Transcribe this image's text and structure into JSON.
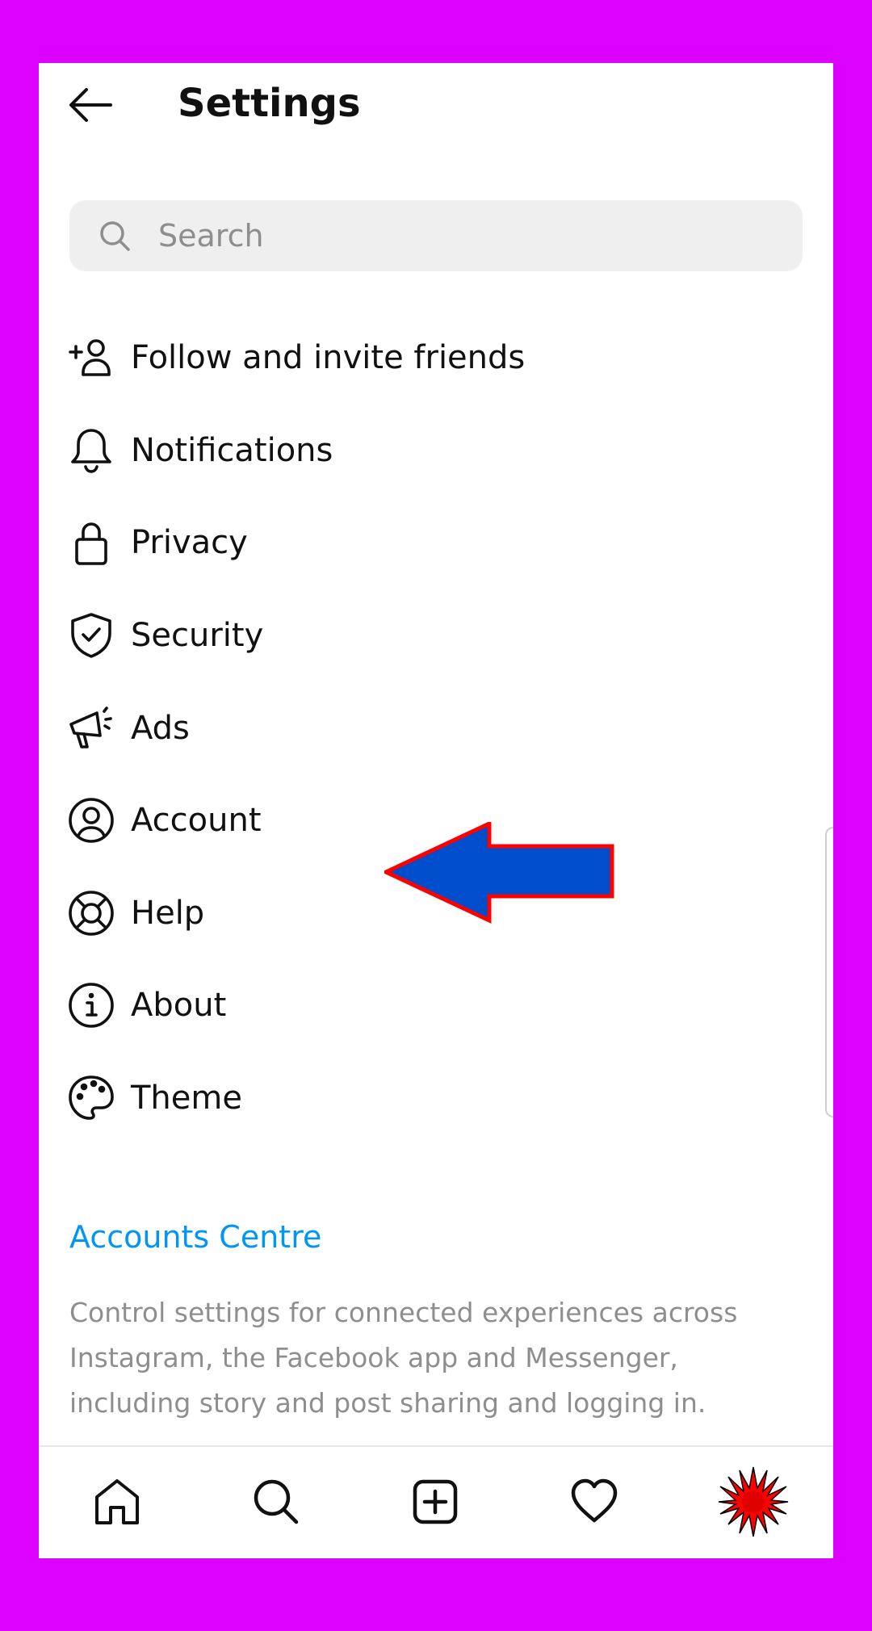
{
  "header": {
    "title": "Settings",
    "back_icon": "arrow-left-icon"
  },
  "search": {
    "placeholder": "Search",
    "value": "",
    "icon": "search-icon"
  },
  "menu": [
    {
      "label": "Follow and invite friends",
      "icon": "add-person-icon"
    },
    {
      "label": "Notifications",
      "icon": "bell-icon"
    },
    {
      "label": "Privacy",
      "icon": "lock-icon"
    },
    {
      "label": "Security",
      "icon": "shield-check-icon"
    },
    {
      "label": "Ads",
      "icon": "megaphone-icon"
    },
    {
      "label": "Account",
      "icon": "user-circle-icon"
    },
    {
      "label": "Help",
      "icon": "lifebuoy-icon"
    },
    {
      "label": "About",
      "icon": "info-icon"
    },
    {
      "label": "Theme",
      "icon": "palette-icon"
    }
  ],
  "accounts_centre": {
    "title": "Accounts Centre",
    "description": "Control settings for connected experiences across Instagram, the Facebook app and Messenger, including story and post sharing and logging in."
  },
  "bottom_nav": [
    {
      "icon": "home-icon"
    },
    {
      "icon": "search-icon"
    },
    {
      "icon": "plus-square-icon"
    },
    {
      "icon": "heart-icon"
    },
    {
      "icon": "profile-avatar-icon"
    }
  ],
  "colors": {
    "background": "#dd02ff",
    "link": "#0095f6",
    "arrow_fill": "#004ecc",
    "arrow_stroke": "#ff0000"
  }
}
